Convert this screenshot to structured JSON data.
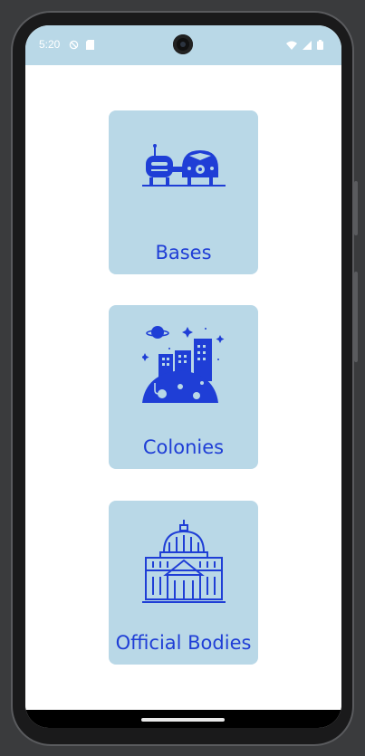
{
  "status_bar": {
    "time": "5:20",
    "icons_left": [
      "shield-icon",
      "sim-card-icon"
    ],
    "icons_right": [
      "wifi-icon",
      "signal-icon",
      "battery-icon"
    ]
  },
  "cards": [
    {
      "label": "Bases",
      "icon": "space-base-icon"
    },
    {
      "label": "Colonies",
      "icon": "city-colony-icon"
    },
    {
      "label": "Official Bodies",
      "icon": "government-building-icon"
    }
  ],
  "colors": {
    "accent": "#1f3ed6",
    "card_bg": "#b9d8e7",
    "status_bar_bg": "#b9d8e7"
  }
}
